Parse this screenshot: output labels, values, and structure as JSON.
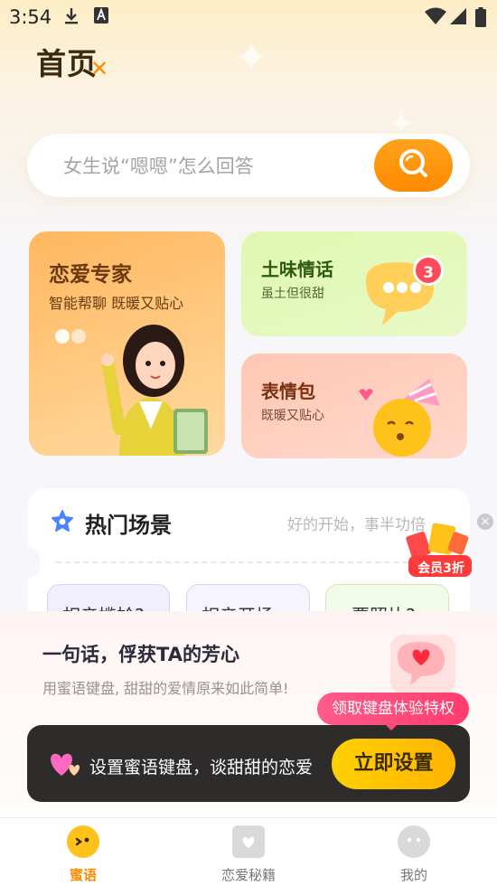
{
  "status_bar": {
    "time": "3:54"
  },
  "app": {
    "title": "首页"
  },
  "search": {
    "placeholder": "女生说“嗯嗯”怎么回答"
  },
  "cards": {
    "expert": {
      "title": "恋爱专家",
      "subtitle": "智能帮聊 既暖又贴心"
    },
    "tuwei": {
      "title": "土味情话",
      "subtitle": "虽土但很甜",
      "badge": "3"
    },
    "emoji": {
      "title": "表情包",
      "subtitle": "既暖又贴心"
    }
  },
  "hot_scenes": {
    "title": "热门场景",
    "slogan": "好的开始，事半功倍",
    "chips": [
      "相亲尴尬?",
      "相亲开场",
      "要照片?"
    ]
  },
  "promo": {
    "label": "会员3折"
  },
  "keyboard": {
    "title": "一句话，俘获TA的芳心",
    "subtitle": "用蜜语键盘, 甜甜的爱情原来如此简单!",
    "tip": "领取键盘体验特权",
    "bar_text": "设置蜜语键盘，谈甜甜的恋爱",
    "button": "立即设置"
  },
  "nav": {
    "items": [
      {
        "label": "蜜语",
        "active": true
      },
      {
        "label": "恋爱秘籍",
        "active": false
      },
      {
        "label": "我的",
        "active": false
      }
    ]
  },
  "colors": {
    "accent": "#ff8a00",
    "active_tab": "#ff8a00",
    "tip": "#ff3c6e"
  }
}
